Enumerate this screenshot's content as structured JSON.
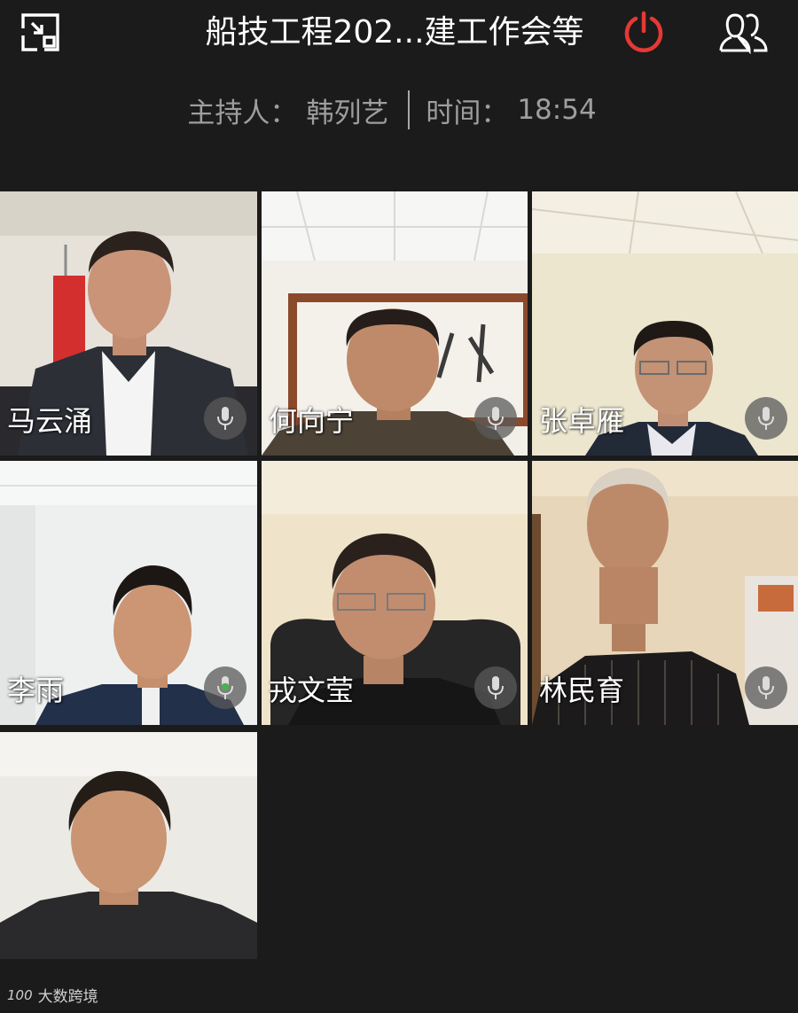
{
  "header": {
    "title": "船技工程202...建工作会等",
    "minimize_icon": "minimize-window-icon",
    "power_icon": "power-icon",
    "participants_icon": "participants-icon",
    "power_color": "#e53935"
  },
  "info": {
    "host_label": "主持人：",
    "host_name": "韩列艺",
    "time_label": "时间：",
    "time_value": "18:54"
  },
  "participants": [
    {
      "name": "马云涌",
      "mic_icon": "microphone-icon",
      "mic_active": false
    },
    {
      "name": "何向宁",
      "mic_icon": "microphone-icon",
      "mic_active": false
    },
    {
      "name": "张卓雁",
      "mic_icon": "microphone-icon",
      "mic_active": false
    },
    {
      "name": "李雨",
      "mic_icon": "microphone-icon",
      "mic_active": true
    },
    {
      "name": "戎文莹",
      "mic_icon": "microphone-icon",
      "mic_active": false
    },
    {
      "name": "林民育",
      "mic_icon": "microphone-icon",
      "mic_active": false
    },
    {
      "name": "",
      "mic_icon": "",
      "mic_active": false
    }
  ],
  "watermark": {
    "logo_text": "100",
    "text": "大数跨境"
  },
  "colors": {
    "background": "#1b1b1b",
    "mic_active": "#4caf50"
  }
}
